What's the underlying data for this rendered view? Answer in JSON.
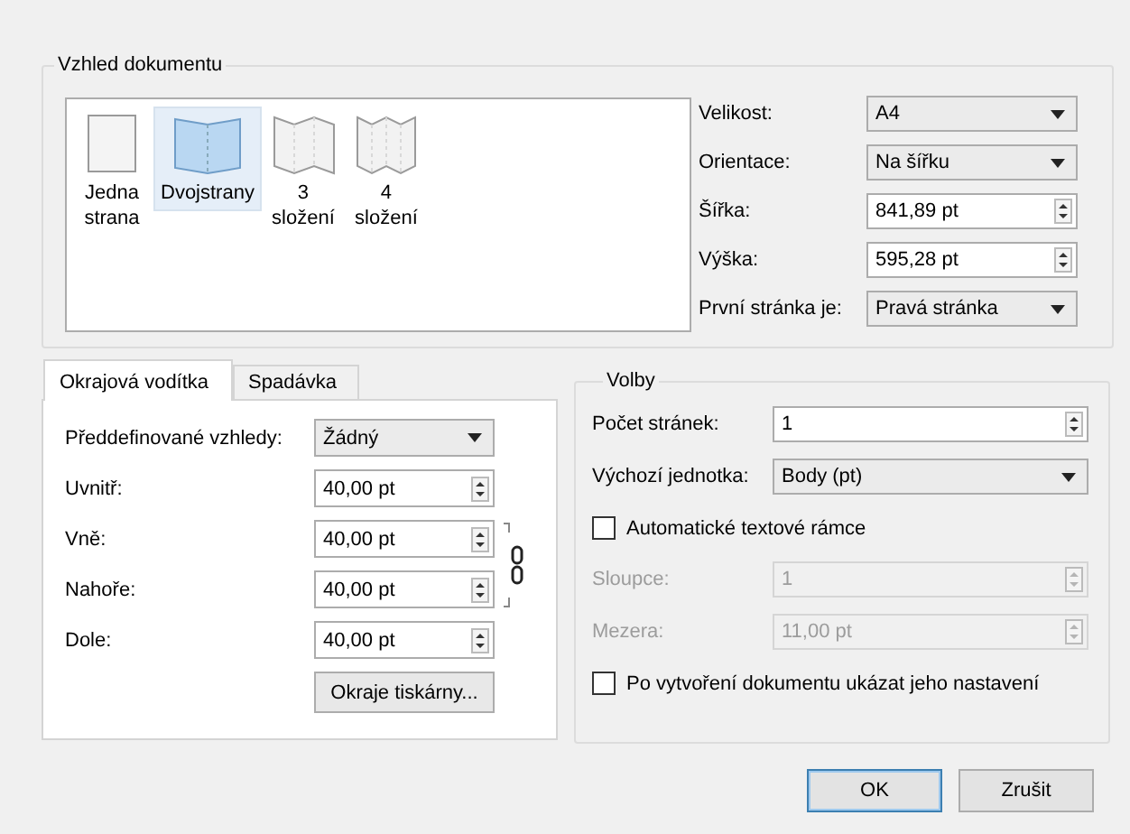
{
  "document_layout": {
    "title": "Vzhled dokumentu",
    "layouts": [
      {
        "kind": "single",
        "label": "Jedna strana",
        "selected": false
      },
      {
        "kind": "double",
        "label": "Dvojstrany",
        "selected": true
      },
      {
        "kind": "fold3",
        "label": "3 složení",
        "selected": false
      },
      {
        "kind": "fold4",
        "label": "4 složení",
        "selected": false
      }
    ],
    "fields": [
      {
        "kind": "select",
        "label": "Velikost:",
        "value": "A4"
      },
      {
        "kind": "select",
        "label": "Orientace:",
        "value": "Na šířku"
      },
      {
        "kind": "spin",
        "label": "Šířka:",
        "value": "841,89 pt"
      },
      {
        "kind": "spin",
        "label": "Výška:",
        "value": "595,28 pt"
      },
      {
        "kind": "select",
        "label": "První stránka je:",
        "value": "Pravá stránka"
      }
    ]
  },
  "tabs": [
    {
      "label": "Okrajová vodítka",
      "selected": true
    },
    {
      "label": "Spadávka",
      "selected": false
    }
  ],
  "margins": {
    "fields": [
      {
        "kind": "select",
        "label": "Předdefinované vzhledy:",
        "value": "Žádný"
      },
      {
        "kind": "spin",
        "label": "Uvnitř:",
        "value": "40,00 pt"
      },
      {
        "kind": "spin",
        "label": "Vně:",
        "value": "40,00 pt"
      },
      {
        "kind": "spin",
        "label": "Nahoře:",
        "value": "40,00 pt"
      },
      {
        "kind": "spin",
        "label": "Dole:",
        "value": "40,00 pt"
      }
    ],
    "button": "Okraje tiskárny..."
  },
  "options": {
    "title": "Volby",
    "rows": [
      {
        "kind": "spin",
        "label": "Počet stránek:",
        "value": "1",
        "disabled": false
      },
      {
        "kind": "select",
        "label": "Výchozí jednotka:",
        "value": "Body (pt)",
        "disabled": false
      },
      {
        "kind": "check",
        "label": "Automatické textové rámce",
        "checked": false
      },
      {
        "kind": "spin",
        "label": "Sloupce:",
        "value": "1",
        "disabled": true
      },
      {
        "kind": "spin",
        "label": "Mezera:",
        "value": "11,00 pt",
        "disabled": true
      },
      {
        "kind": "check",
        "label": "Po vytvoření dokumentu ukázat jeho nastavení",
        "checked": false
      }
    ]
  },
  "buttons": [
    {
      "label": "OK",
      "default": true
    },
    {
      "label": "Zrušit",
      "default": false
    }
  ]
}
